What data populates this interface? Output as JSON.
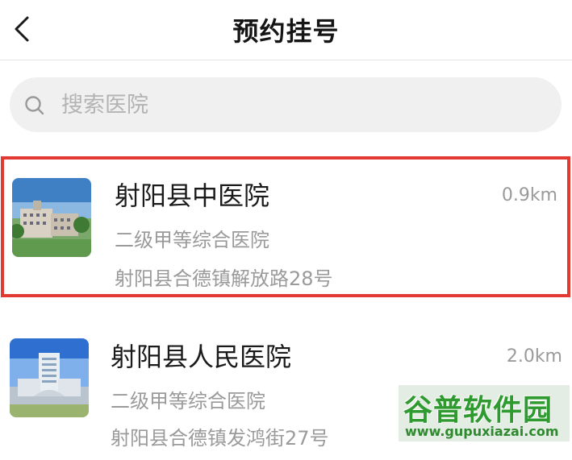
{
  "header": {
    "title": "预约挂号",
    "back_icon": "chevron-left-icon"
  },
  "search": {
    "placeholder": "搜索医院",
    "icon": "search-icon"
  },
  "hospitals": [
    {
      "name": "射阳县中医院",
      "level": "二级甲等综合医院",
      "address": "射阳县合德镇解放路28号",
      "distance": "0.9km",
      "selected": true
    },
    {
      "name": "射阳县人民医院",
      "level": "二级甲等综合医院",
      "address": "射阳县合德镇发鸿街27号",
      "distance": "2.0km",
      "selected": false
    }
  ],
  "colors": {
    "selection_border": "#e23a32",
    "secondary_text": "#9a9a9a",
    "search_bg": "#f0f0f0"
  },
  "watermark": {
    "brand": "谷普软件园",
    "url": "www.gupuxiazai.com"
  }
}
